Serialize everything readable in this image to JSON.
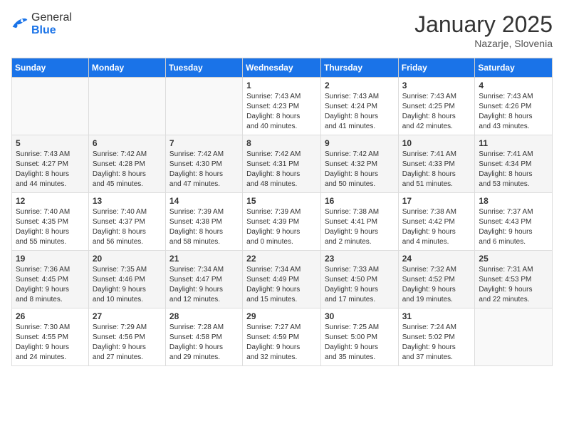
{
  "header": {
    "logo_general": "General",
    "logo_blue": "Blue",
    "month_title": "January 2025",
    "location": "Nazarje, Slovenia"
  },
  "weekdays": [
    "Sunday",
    "Monday",
    "Tuesday",
    "Wednesday",
    "Thursday",
    "Friday",
    "Saturday"
  ],
  "weeks": [
    [
      {
        "day": "",
        "info": ""
      },
      {
        "day": "",
        "info": ""
      },
      {
        "day": "",
        "info": ""
      },
      {
        "day": "1",
        "info": "Sunrise: 7:43 AM\nSunset: 4:23 PM\nDaylight: 8 hours\nand 40 minutes."
      },
      {
        "day": "2",
        "info": "Sunrise: 7:43 AM\nSunset: 4:24 PM\nDaylight: 8 hours\nand 41 minutes."
      },
      {
        "day": "3",
        "info": "Sunrise: 7:43 AM\nSunset: 4:25 PM\nDaylight: 8 hours\nand 42 minutes."
      },
      {
        "day": "4",
        "info": "Sunrise: 7:43 AM\nSunset: 4:26 PM\nDaylight: 8 hours\nand 43 minutes."
      }
    ],
    [
      {
        "day": "5",
        "info": "Sunrise: 7:43 AM\nSunset: 4:27 PM\nDaylight: 8 hours\nand 44 minutes."
      },
      {
        "day": "6",
        "info": "Sunrise: 7:42 AM\nSunset: 4:28 PM\nDaylight: 8 hours\nand 45 minutes."
      },
      {
        "day": "7",
        "info": "Sunrise: 7:42 AM\nSunset: 4:30 PM\nDaylight: 8 hours\nand 47 minutes."
      },
      {
        "day": "8",
        "info": "Sunrise: 7:42 AM\nSunset: 4:31 PM\nDaylight: 8 hours\nand 48 minutes."
      },
      {
        "day": "9",
        "info": "Sunrise: 7:42 AM\nSunset: 4:32 PM\nDaylight: 8 hours\nand 50 minutes."
      },
      {
        "day": "10",
        "info": "Sunrise: 7:41 AM\nSunset: 4:33 PM\nDaylight: 8 hours\nand 51 minutes."
      },
      {
        "day": "11",
        "info": "Sunrise: 7:41 AM\nSunset: 4:34 PM\nDaylight: 8 hours\nand 53 minutes."
      }
    ],
    [
      {
        "day": "12",
        "info": "Sunrise: 7:40 AM\nSunset: 4:35 PM\nDaylight: 8 hours\nand 55 minutes."
      },
      {
        "day": "13",
        "info": "Sunrise: 7:40 AM\nSunset: 4:37 PM\nDaylight: 8 hours\nand 56 minutes."
      },
      {
        "day": "14",
        "info": "Sunrise: 7:39 AM\nSunset: 4:38 PM\nDaylight: 8 hours\nand 58 minutes."
      },
      {
        "day": "15",
        "info": "Sunrise: 7:39 AM\nSunset: 4:39 PM\nDaylight: 9 hours\nand 0 minutes."
      },
      {
        "day": "16",
        "info": "Sunrise: 7:38 AM\nSunset: 4:41 PM\nDaylight: 9 hours\nand 2 minutes."
      },
      {
        "day": "17",
        "info": "Sunrise: 7:38 AM\nSunset: 4:42 PM\nDaylight: 9 hours\nand 4 minutes."
      },
      {
        "day": "18",
        "info": "Sunrise: 7:37 AM\nSunset: 4:43 PM\nDaylight: 9 hours\nand 6 minutes."
      }
    ],
    [
      {
        "day": "19",
        "info": "Sunrise: 7:36 AM\nSunset: 4:45 PM\nDaylight: 9 hours\nand 8 minutes."
      },
      {
        "day": "20",
        "info": "Sunrise: 7:35 AM\nSunset: 4:46 PM\nDaylight: 9 hours\nand 10 minutes."
      },
      {
        "day": "21",
        "info": "Sunrise: 7:34 AM\nSunset: 4:47 PM\nDaylight: 9 hours\nand 12 minutes."
      },
      {
        "day": "22",
        "info": "Sunrise: 7:34 AM\nSunset: 4:49 PM\nDaylight: 9 hours\nand 15 minutes."
      },
      {
        "day": "23",
        "info": "Sunrise: 7:33 AM\nSunset: 4:50 PM\nDaylight: 9 hours\nand 17 minutes."
      },
      {
        "day": "24",
        "info": "Sunrise: 7:32 AM\nSunset: 4:52 PM\nDaylight: 9 hours\nand 19 minutes."
      },
      {
        "day": "25",
        "info": "Sunrise: 7:31 AM\nSunset: 4:53 PM\nDaylight: 9 hours\nand 22 minutes."
      }
    ],
    [
      {
        "day": "26",
        "info": "Sunrise: 7:30 AM\nSunset: 4:55 PM\nDaylight: 9 hours\nand 24 minutes."
      },
      {
        "day": "27",
        "info": "Sunrise: 7:29 AM\nSunset: 4:56 PM\nDaylight: 9 hours\nand 27 minutes."
      },
      {
        "day": "28",
        "info": "Sunrise: 7:28 AM\nSunset: 4:58 PM\nDaylight: 9 hours\nand 29 minutes."
      },
      {
        "day": "29",
        "info": "Sunrise: 7:27 AM\nSunset: 4:59 PM\nDaylight: 9 hours\nand 32 minutes."
      },
      {
        "day": "30",
        "info": "Sunrise: 7:25 AM\nSunset: 5:00 PM\nDaylight: 9 hours\nand 35 minutes."
      },
      {
        "day": "31",
        "info": "Sunrise: 7:24 AM\nSunset: 5:02 PM\nDaylight: 9 hours\nand 37 minutes."
      },
      {
        "day": "",
        "info": ""
      }
    ]
  ]
}
